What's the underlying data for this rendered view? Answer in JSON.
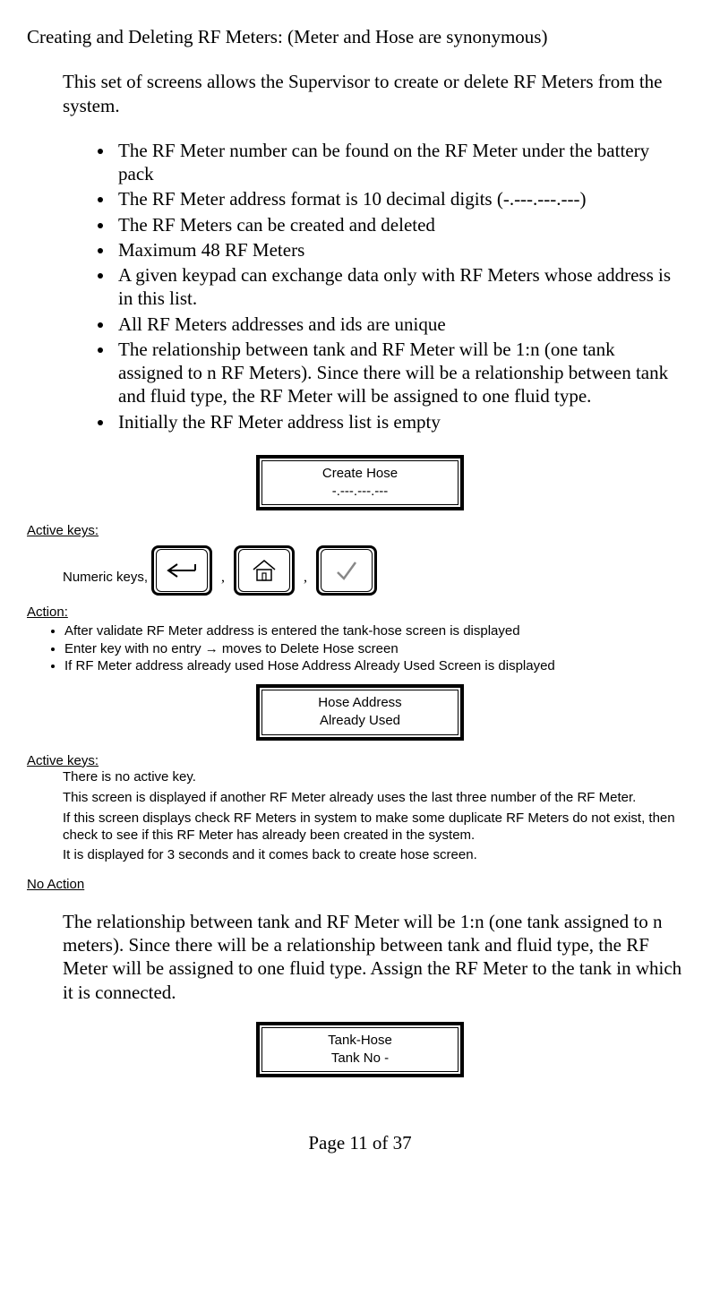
{
  "heading": "Creating and Deleting RF Meters:  (Meter and Hose are synonymous)",
  "intro": "This set of screens allows the Supervisor to create or delete RF Meters from the system.",
  "mainBullets": [
    "The RF Meter number can be found on the RF Meter under the battery pack",
    "The RF Meter address format is 10 decimal digits (-.---.---.---)",
    "The RF Meters can be created and deleted",
    "Maximum 48 RF Meters",
    "A given keypad can exchange data only with RF Meters whose address is in this list.",
    "All RF Meters addresses and ids are unique",
    "The relationship between tank and RF Meter will be 1:n (one tank assigned to n RF Meters). Since there will be a relationship between tank and fluid type, the RF Meter will be assigned to one fluid type.",
    "Initially the RF Meter address list is empty"
  ],
  "lcd1": {
    "line1": "Create Hose",
    "line2": "-.---.---.---"
  },
  "activeKeysLabel": "Active keys:",
  "numericKeysText": "Numeric keys,",
  "comma": ",",
  "actionLabel": "Action:",
  "actionBullets": [
    "After validate RF Meter address is entered the tank-hose screen is displayed",
    "Enter key with no entry → moves to Delete Hose screen",
    "If RF Meter address already used Hose Address Already Used Screen is displayed"
  ],
  "lcd2": {
    "line1": "Hose Address",
    "line2": "Already Used"
  },
  "activeKeys2": {
    "noKey": "There is no active key.",
    "l1": "This screen is displayed if another RF Meter already uses the last three number of the RF Meter.",
    "l2": "If this screen displays check RF Meters in system to make some duplicate RF Meters do not exist, then check to see if this RF Meter has already been created in the system.",
    "l3": "It is displayed for 3 seconds and it comes back to create hose screen."
  },
  "noActionLabel": "No Action",
  "para2": "The relationship between tank and RF Meter will be 1:n (one tank assigned to n meters). Since there will be a relationship between tank and fluid type, the RF Meter will be assigned to one fluid type.  Assign the RF Meter to the tank in which it is connected.",
  "lcd3": {
    "line1": "Tank-Hose",
    "line2": "Tank No -"
  },
  "footer": "Page 11 of 37"
}
